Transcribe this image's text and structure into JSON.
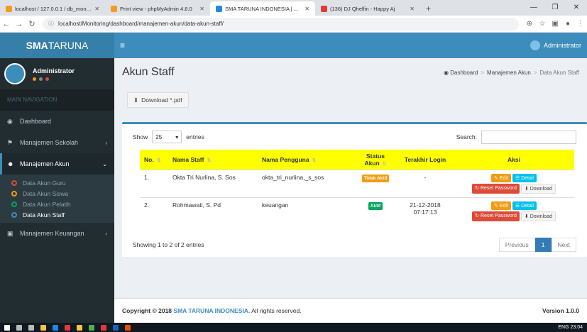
{
  "browser": {
    "tabs": [
      {
        "title": "localhost / 127.0.0.1 / db_monito",
        "color": "#f29c1f"
      },
      {
        "title": "Print view - phpMyAdmin 4.8.0",
        "color": "#f29c1f"
      },
      {
        "title": "SMA TARUNA INDONESIA | Adm",
        "color": "#1e88e5"
      },
      {
        "title": "(136) DJ Qhelfin - Happy Aj",
        "color": "#e53935"
      }
    ],
    "new_tab": "+",
    "address": "localhost/Monitoring/dashboard/manajemen-akun/data-akun-staff/"
  },
  "header": {
    "logo_bold": "SMA",
    "logo_rest": "TARUNA",
    "user": "Administrator"
  },
  "sidebar": {
    "user_name": "Administrator",
    "section_label": "MAIN NAVIGATION",
    "items": [
      {
        "label": "Dashboard"
      },
      {
        "label": "Manajemen Sekolah"
      },
      {
        "label": "Manajemen Akun"
      },
      {
        "label": "Manajemen Keuangan"
      }
    ],
    "submenu": [
      {
        "label": "Data Akun Guru",
        "color": "#dd4b39"
      },
      {
        "label": "Data Akun Siswa",
        "color": "#f39c12"
      },
      {
        "label": "Data Akun Pelatih",
        "color": "#00a65a"
      },
      {
        "label": "Data Akun Staff",
        "color": "#3c8dbc"
      }
    ]
  },
  "content": {
    "title": "Akun Staff",
    "breadcrumb": [
      "Dashboard",
      "Manajemen Akun",
      "Data Akun Staff"
    ],
    "download_label": "Download *.pdf",
    "show_label": "Show",
    "entries_value": "25",
    "entries_label": "entries",
    "search_label": "Search:",
    "columns": [
      "No.",
      "Nama Staff",
      "Nama Pengguna",
      "Status Akun",
      "Terakhir Login",
      "Aksi"
    ],
    "rows": [
      {
        "no": "1.",
        "name": "Okta Tri Nurlina, S. Sos",
        "username": "okta_tri_nurlina,_s_sos",
        "status": "Tidak Aktif",
        "status_color": "#f39c12",
        "last_login": "-",
        "login_time": ""
      },
      {
        "no": "2.",
        "name": "Rohmawati, S. Pd",
        "username": "keuangan",
        "status": "Aktif",
        "status_color": "#00a65a",
        "last_login": "21-12-2018",
        "login_time": "07:17:13"
      }
    ],
    "actions": {
      "edit": "Edit",
      "detail": "Detail",
      "reset": "Reset Password",
      "download": "Download"
    },
    "showing": "Showing 1 to 2 of 2 entries",
    "pager": {
      "prev": "Previous",
      "page": "1",
      "next": "Next"
    }
  },
  "footer": {
    "copy_prefix": "Copyright © 2018",
    "brand": "SMA TARUNA INDONESIA.",
    "rights": "All rights reserved.",
    "version": "Version 1.0.0"
  },
  "taskbar": {
    "tray": "ENG",
    "time": "23:04"
  }
}
